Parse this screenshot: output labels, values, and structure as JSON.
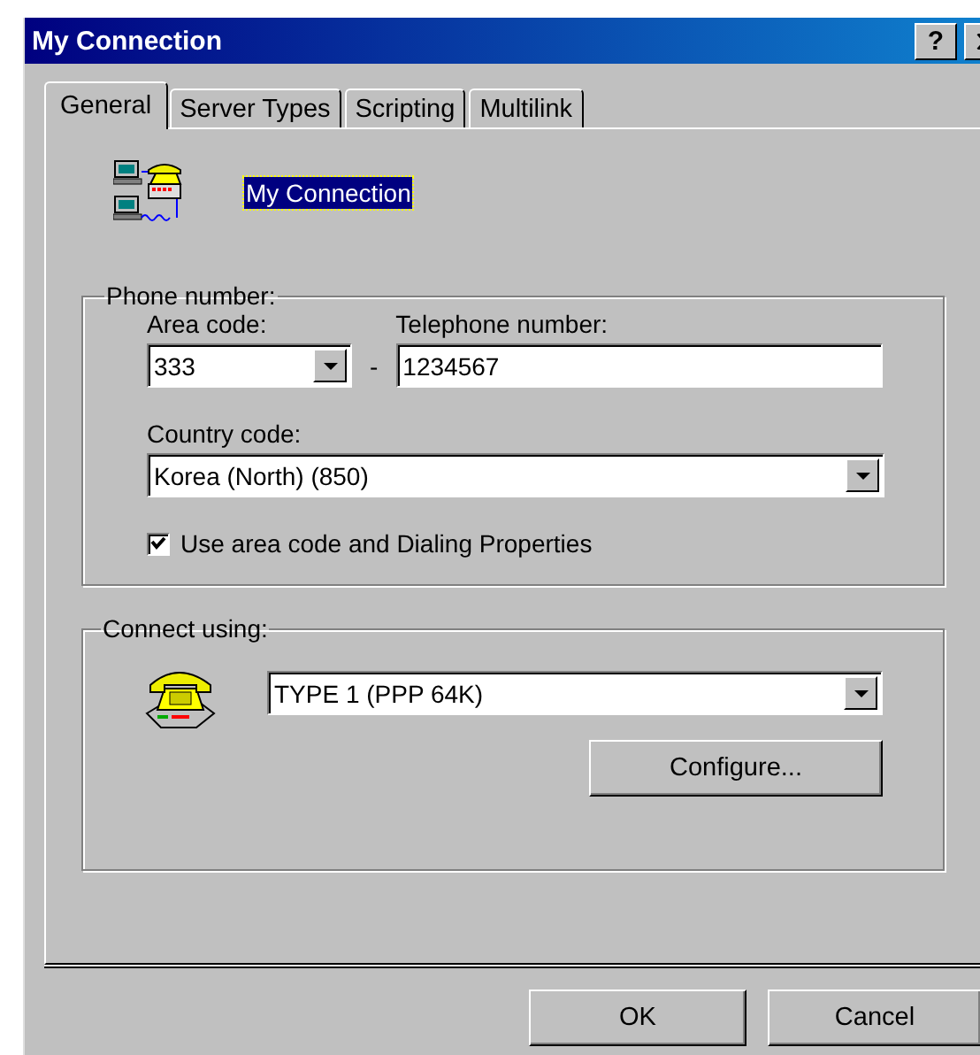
{
  "window": {
    "title": "My Connection",
    "help_button": "?"
  },
  "tabs": [
    {
      "label": "General",
      "selected": true
    },
    {
      "label": "Server Types",
      "selected": false
    },
    {
      "label": "Scripting",
      "selected": false
    },
    {
      "label": "Multilink",
      "selected": false
    }
  ],
  "connection": {
    "name": "My Connection",
    "selected": true
  },
  "phone_number": {
    "title": "Phone number:",
    "area_code": {
      "label": "Area code:",
      "value": "333"
    },
    "separator": "-",
    "telephone": {
      "label": "Telephone number:",
      "value": "1234567"
    },
    "country_code": {
      "label": "Country code:",
      "value": "Korea (North) (850)"
    },
    "use_dialing": {
      "label": "Use area code and Dialing Properties",
      "checked": true
    }
  },
  "connect_using": {
    "title": "Connect using:",
    "device": "TYPE 1 (PPP 64K)",
    "configure_button": "Configure..."
  },
  "buttons": [
    {
      "label": "OK"
    },
    {
      "label": "Cancel"
    }
  ]
}
